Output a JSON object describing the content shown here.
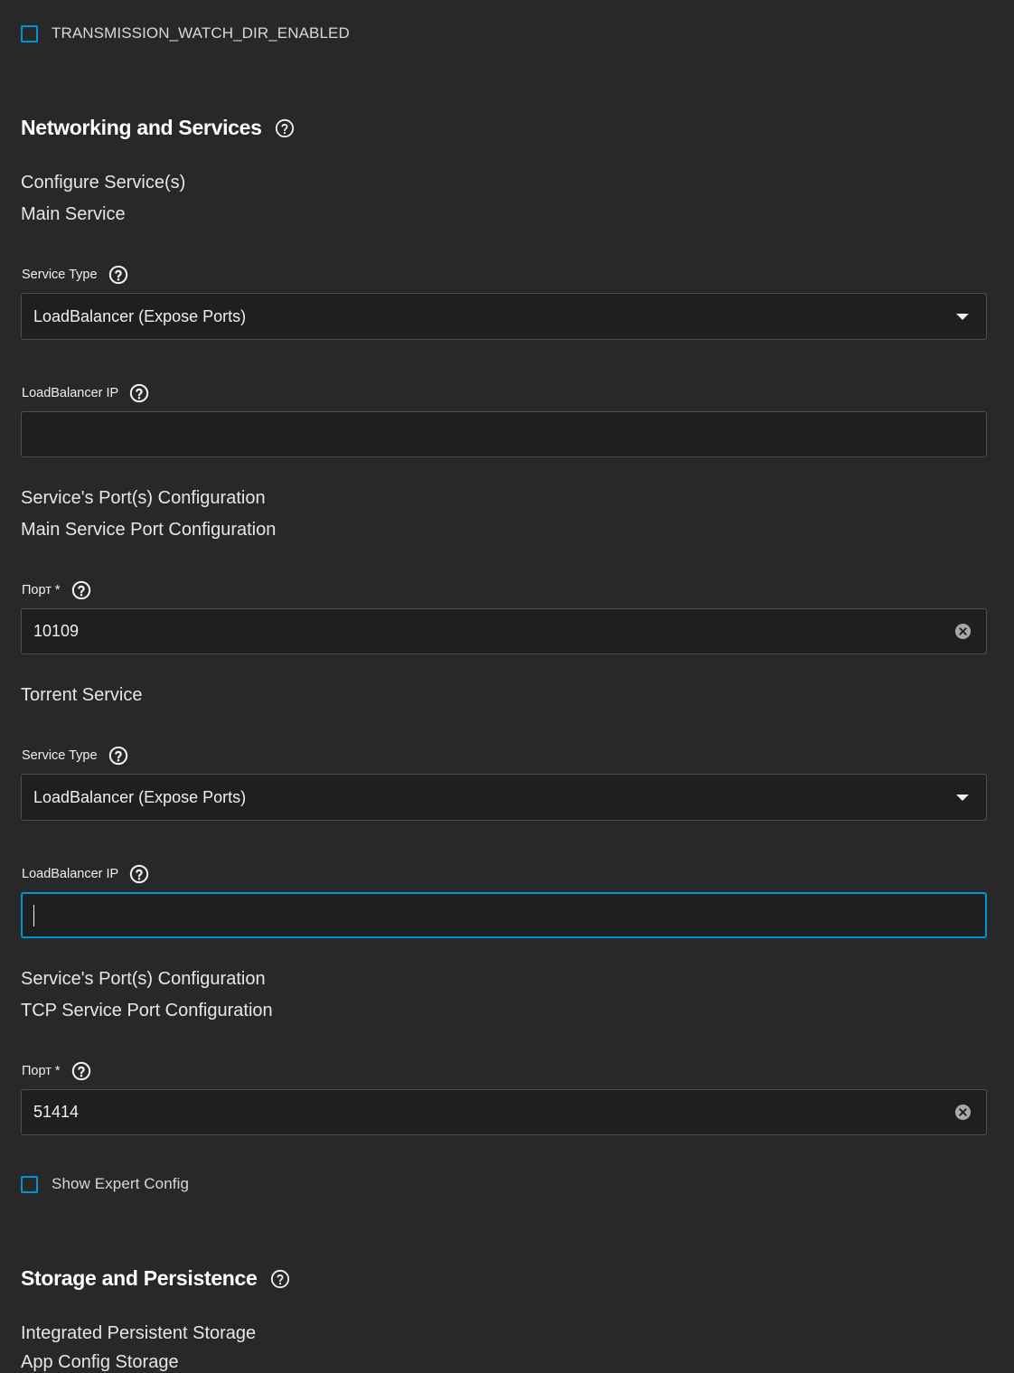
{
  "top_checkbox": {
    "label": "TRANSMISSION_WATCH_DIR_ENABLED",
    "checked": false
  },
  "networking": {
    "title": "Networking and Services",
    "configure_label": "Configure Service(s)",
    "main_service": {
      "heading": "Main Service",
      "service_type_label": "Service Type",
      "service_type_value": "LoadBalancer (Expose Ports)",
      "lb_ip_label": "LoadBalancer IP",
      "lb_ip_value": "",
      "ports_heading": "Service's Port(s) Configuration",
      "port_config_heading": "Main Service Port Configuration",
      "port_label": "Порт *",
      "port_value": "10109"
    },
    "torrent_service": {
      "heading": "Torrent Service",
      "service_type_label": "Service Type",
      "service_type_value": "LoadBalancer (Expose Ports)",
      "lb_ip_label": "LoadBalancer IP",
      "lb_ip_value": "",
      "ports_heading": "Service's Port(s) Configuration",
      "port_config_heading": "TCP Service Port Configuration",
      "port_label": "Порт *",
      "port_value": "51414"
    },
    "expert_checkbox": {
      "label": "Show Expert Config",
      "checked": false
    }
  },
  "storage": {
    "title": "Storage and Persistence",
    "integrated_label": "Integrated Persistent Storage",
    "app_config_label": "App Config Storage"
  },
  "colors": {
    "background": "#282828",
    "input_background": "#1f1f1f",
    "accent": "#0095d5",
    "border": "#4a4f55"
  },
  "icons": {
    "help_outline": "help-circle-outline-icon",
    "help_solid": "help-circle-icon",
    "dropdown": "arrow-drop-down-icon",
    "clear": "cancel-circle-icon"
  }
}
